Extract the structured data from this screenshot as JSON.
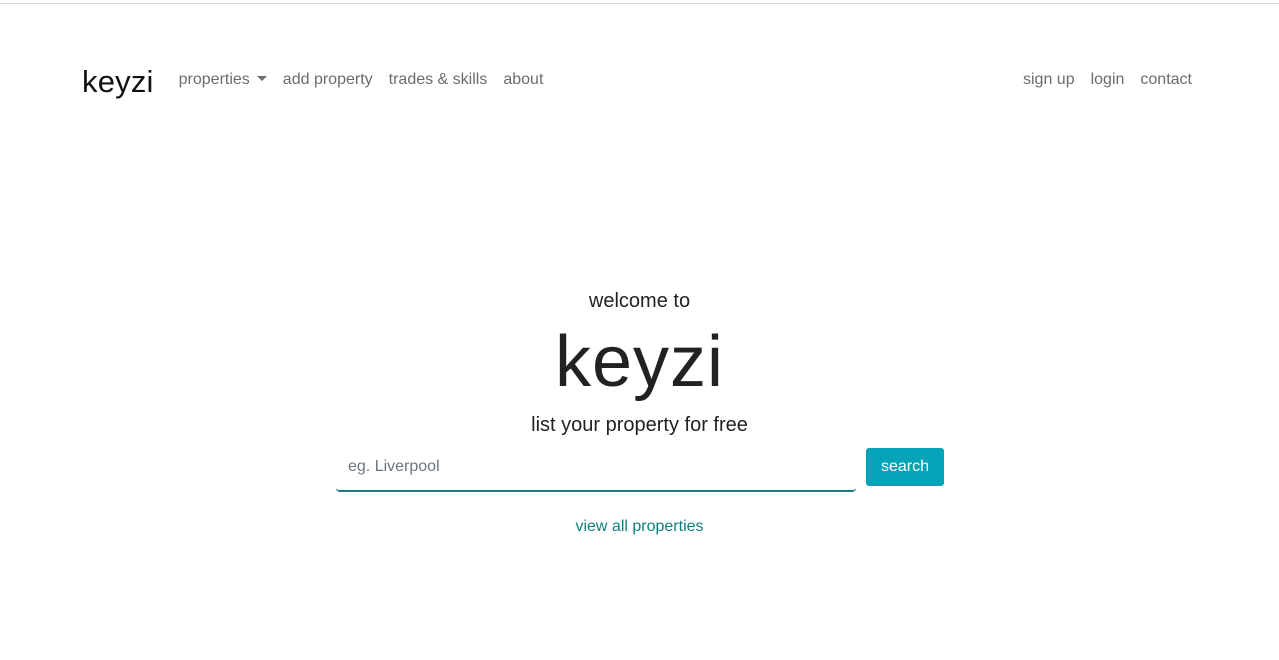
{
  "navbar": {
    "brand": "keyzi",
    "left_items": [
      {
        "label": "properties",
        "has_dropdown": true
      },
      {
        "label": "add property"
      },
      {
        "label": "trades & skills"
      },
      {
        "label": "about"
      }
    ],
    "right_items": [
      {
        "label": "sign up"
      },
      {
        "label": "login"
      },
      {
        "label": "contact"
      }
    ]
  },
  "hero": {
    "welcome": "welcome to",
    "title": "keyzi",
    "tagline": "list your property for free"
  },
  "search": {
    "value": "",
    "placeholder": "eg. Liverpool",
    "button_label": "search"
  },
  "view_all_link": "view all properties",
  "colors": {
    "accent_button": "#06a2b8",
    "link_teal": "#0f7f7d",
    "input_underline": "#1a7b84",
    "nav_text": "#6c6c6c"
  }
}
